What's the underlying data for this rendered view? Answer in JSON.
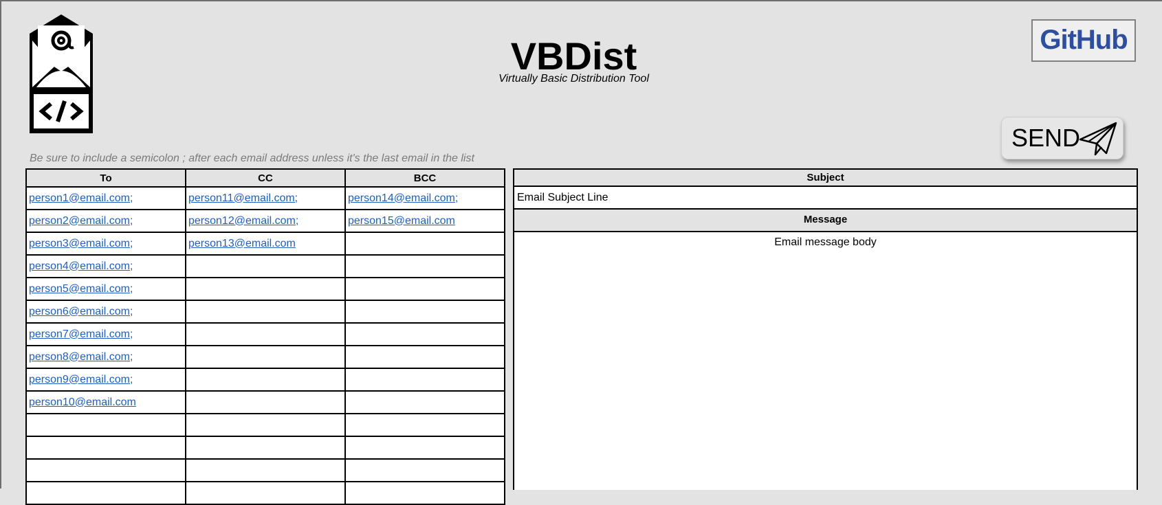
{
  "app": {
    "title": "VBDist",
    "subtitle": "Virtually Basic Distribution Tool",
    "logo_icon": "email-code-icon",
    "github_label": "GitHub",
    "send_label": "SEND",
    "send_icon": "paper-plane-icon"
  },
  "instructions": "Be sure to include a semicolon ; after each email address unless it's the last email in the list",
  "recipients": {
    "headers": {
      "to": "To",
      "cc": "CC",
      "bcc": "BCC"
    },
    "rows": [
      {
        "to": "person1@email.com;",
        "cc": "person11@email.com;",
        "bcc": "person14@email.com;"
      },
      {
        "to": "person2@email.com;",
        "cc": "person12@email.com;",
        "bcc": "person15@email.com"
      },
      {
        "to": "person3@email.com;",
        "cc": "person13@email.com",
        "bcc": ""
      },
      {
        "to": "person4@email.com;",
        "cc": "",
        "bcc": ""
      },
      {
        "to": "person5@email.com;",
        "cc": "",
        "bcc": ""
      },
      {
        "to": "person6@email.com;",
        "cc": "",
        "bcc": ""
      },
      {
        "to": "person7@email.com;",
        "cc": "",
        "bcc": ""
      },
      {
        "to": "person8@email.com;",
        "cc": "",
        "bcc": ""
      },
      {
        "to": "person9@email.com;",
        "cc": "",
        "bcc": ""
      },
      {
        "to": "person10@email.com",
        "cc": "",
        "bcc": ""
      },
      {
        "to": "",
        "cc": "",
        "bcc": ""
      },
      {
        "to": "",
        "cc": "",
        "bcc": ""
      },
      {
        "to": "",
        "cc": "",
        "bcc": ""
      },
      {
        "to": "",
        "cc": "",
        "bcc": ""
      }
    ]
  },
  "email": {
    "subject_header": "Subject",
    "subject_value": "Email Subject Line",
    "message_header": "Message",
    "message_body": "Email message body"
  },
  "colors": {
    "background": "#e3e3e3",
    "link": "#1f5fc0",
    "github": "#2e4f9e",
    "instructions": "#7b7b7b"
  }
}
